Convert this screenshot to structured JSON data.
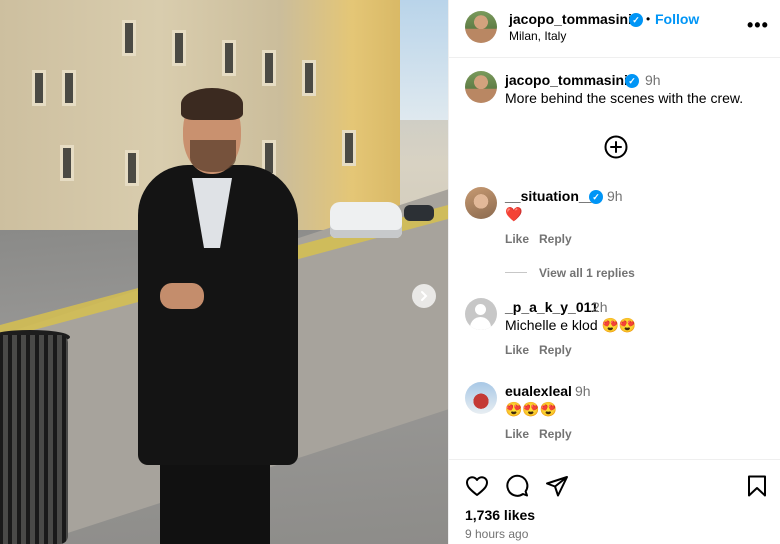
{
  "post": {
    "author": "jacopo_tommasini",
    "follow_label": "Follow",
    "separator": "•",
    "location": "Milan, Italy",
    "more_label": "•••",
    "caption": {
      "user": "jacopo_tommasini",
      "time": "9h",
      "text": "More behind the scenes with the crew."
    }
  },
  "comments": [
    {
      "user": "__situation__",
      "verified": true,
      "time": "9h",
      "text": "❤️",
      "like": "Like",
      "reply": "Reply",
      "view_replies": "View all 1 replies"
    },
    {
      "user": "_p_a_k_y_011",
      "verified": false,
      "time": "2h",
      "text": "Michelle e klod 😍😍",
      "like": "Like",
      "reply": "Reply"
    },
    {
      "user": "eualexleal",
      "verified": false,
      "time": "9h",
      "text": "😍😍😍",
      "like": "Like",
      "reply": "Reply"
    }
  ],
  "footer": {
    "likes": "1,736 likes",
    "time_ago": "9 hours ago"
  },
  "icons": {
    "verified": "verified-badge-icon",
    "next": "chevron-right-icon",
    "add": "plus-circle-icon",
    "like": "heart-icon",
    "comment": "comment-bubble-icon",
    "share": "paper-plane-icon",
    "save": "bookmark-icon"
  },
  "colors": {
    "accent": "#0095f6",
    "muted": "#737373"
  }
}
